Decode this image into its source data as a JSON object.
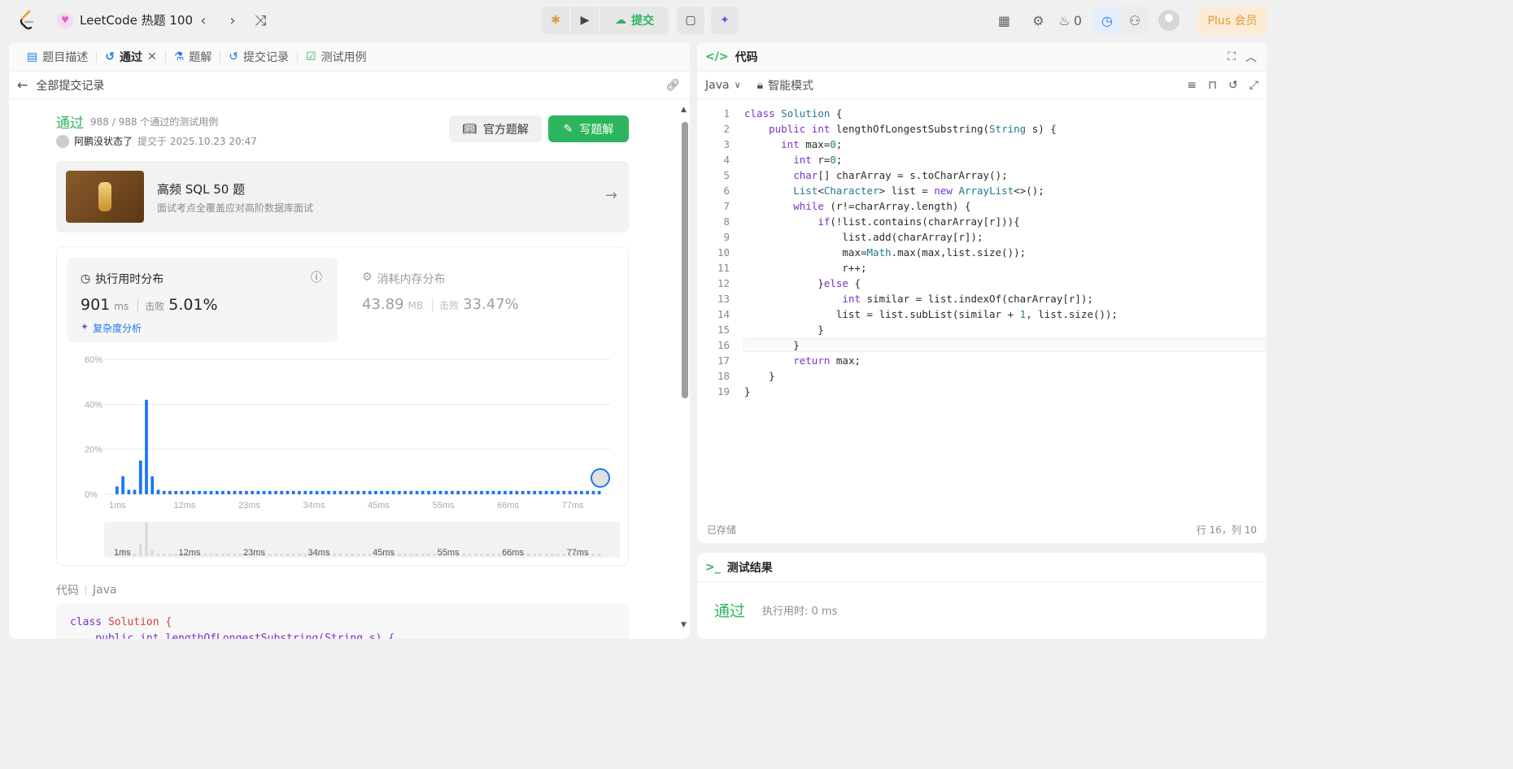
{
  "top": {
    "list_title": "LeetCode 热题 100",
    "submit_label": "提交",
    "fire_count": "0",
    "plus_label": "Plus 会员"
  },
  "left": {
    "tabs": [
      "题目描述",
      "通过",
      "题解",
      "提交记录",
      "测试用例"
    ],
    "back_label": "全部提交记录",
    "status": "通过",
    "pass_count": "988 / 988 个通过的测试用例",
    "user_name": "阿鹏没状态了",
    "submitted_at": "提交于 2025.10.23 20:47",
    "official_solution": "官方题解",
    "write_solution": "写题解",
    "promo_title": "高频 SQL 50 题",
    "promo_desc": "面试考点全覆盖应对高阶数据库面试",
    "runtime_title": "执行用时分布",
    "runtime_value": "901",
    "runtime_unit": "ms",
    "beats_label": "击败",
    "runtime_beats": "5.01%",
    "complexity": "复杂度分析",
    "memory_title": "消耗内存分布",
    "memory_value": "43.89",
    "memory_unit": "MB",
    "memory_beats": "33.47%",
    "code_label": "代码",
    "code_lang": "Java",
    "code_line1_kw": "class",
    "code_line1_name": "Solution {",
    "code_line2": "    public int lengthOfLongestSubstring(String s) {"
  },
  "chart_data": {
    "type": "bar",
    "ylabel_ticks": [
      "0%",
      "20%",
      "40%",
      "60%"
    ],
    "x_ticks": [
      "1ms",
      "12ms",
      "23ms",
      "34ms",
      "45ms",
      "55ms",
      "66ms",
      "77ms"
    ],
    "ylim": [
      0,
      60
    ],
    "values": [
      3.5,
      8,
      2,
      2,
      15,
      42,
      8,
      2,
      1.5,
      1.5,
      1.5,
      1.5,
      1.5,
      1.5,
      1.5,
      1.5,
      1.5,
      1.5,
      1.5,
      1.5,
      1.5,
      1.5,
      1.5,
      1.5,
      1.5,
      1.5,
      1.5,
      1.5,
      1.5,
      1.5,
      1.5,
      1.5,
      1.5,
      1.5,
      1.5,
      1.5,
      1.5,
      1.5,
      1.5,
      1.5,
      1.5,
      1.5,
      1.5,
      1.5,
      1.5,
      1.5,
      1.5,
      1.5,
      1.5,
      1.5,
      1.5,
      1.5,
      1.5,
      1.5,
      1.5,
      1.5,
      1.5,
      1.5,
      1.5,
      1.5,
      1.5,
      1.5,
      1.5,
      1.5,
      1.5,
      1.5,
      1.5,
      1.5,
      1.5,
      1.5,
      1.5,
      1.5,
      1.5,
      1.5,
      1.5,
      1.5,
      1.5,
      1.5,
      1.5,
      1.5,
      1.5,
      1.5,
      1.5
    ],
    "bar_color": "#1877f2",
    "grid": true
  },
  "right": {
    "title": "代码",
    "language": "Java",
    "mode": "智能模式",
    "saved": "已存储",
    "cursor": "行 16，列 10",
    "lines": [
      "class Solution {",
      "    public int lengthOfLongestSubstring(String s) {",
      "      int max=0;",
      "        int r=0;",
      "        char[] charArray = s.toCharArray();",
      "        List<Character> list = new ArrayList<>();",
      "        while (r!=charArray.length) {",
      "            if(!list.contains(charArray[r])){",
      "                list.add(charArray[r]);",
      "                max=Math.max(max,list.size());",
      "                r++;",
      "            }else {",
      "                int similar = list.indexOf(charArray[r]);",
      "               list = list.subList(similar + 1, list.size());",
      "            }",
      "        }",
      "        return max;",
      "    }",
      "}"
    ]
  },
  "result": {
    "title": "测试结果",
    "status": "通过",
    "time": "执行用时: 0 ms"
  }
}
